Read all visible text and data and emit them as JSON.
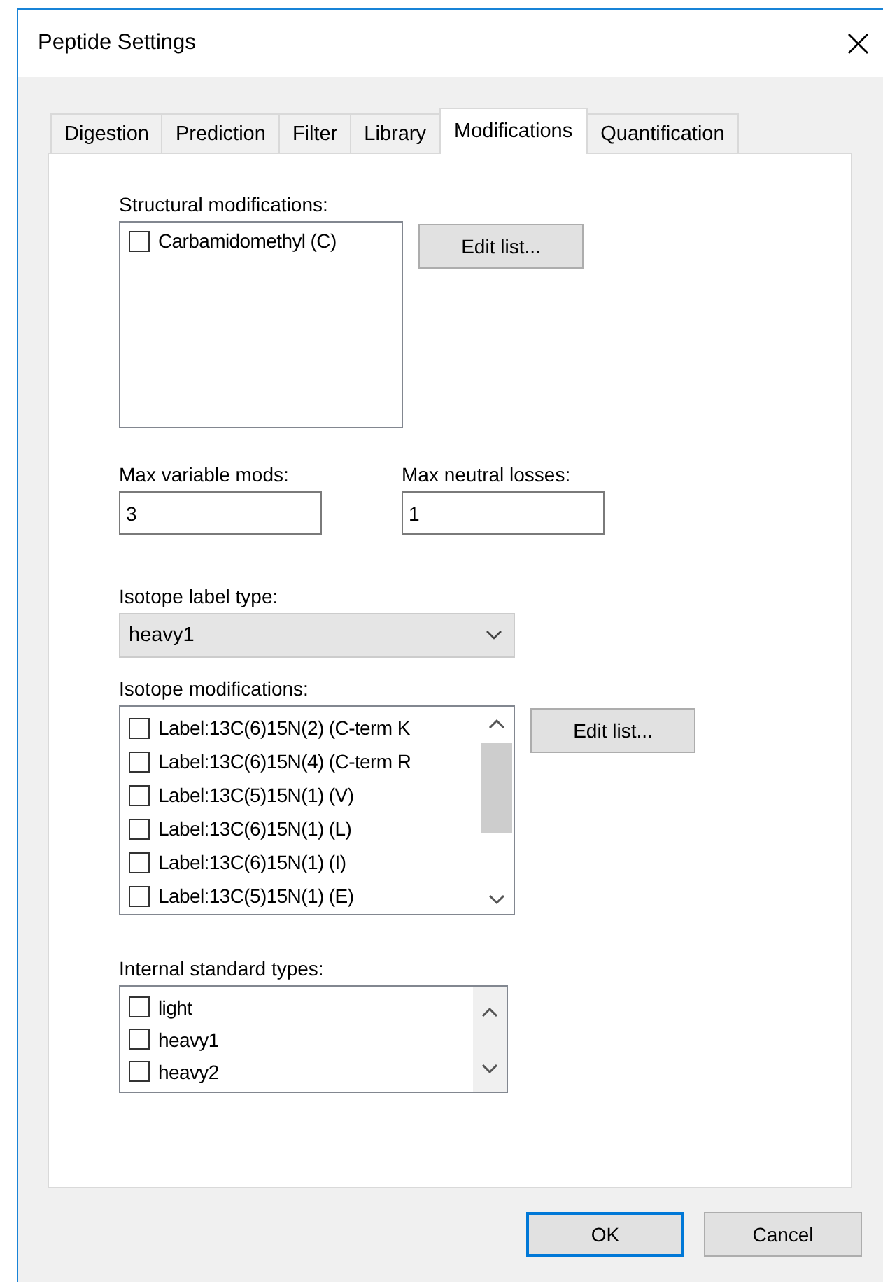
{
  "window": {
    "title": "Peptide Settings",
    "close": "×"
  },
  "tabs": [
    {
      "label": "Digestion",
      "selected": false
    },
    {
      "label": "Prediction",
      "selected": false
    },
    {
      "label": "Filter",
      "selected": false
    },
    {
      "label": "Library",
      "selected": false
    },
    {
      "label": "Modifications",
      "selected": true
    },
    {
      "label": "Quantification",
      "selected": false
    }
  ],
  "structural_modifications": {
    "label": "Structural modifications:",
    "items": [
      {
        "label": "Carbamidomethyl (C)",
        "checked": false
      }
    ],
    "button": "Edit list..."
  },
  "max_variable_mods": {
    "label": "Max variable mods:",
    "value": "3"
  },
  "max_neutral_losses": {
    "label": "Max neutral losses:",
    "value": "1"
  },
  "isotope_label_type": {
    "label": "Isotope label type:",
    "value": "heavy1"
  },
  "isotope_modifications": {
    "label": "Isotope modifications:",
    "items": [
      {
        "label": "Label:13C(6)15N(2) (C-term K",
        "checked": false
      },
      {
        "label": "Label:13C(6)15N(4) (C-term R",
        "checked": false
      },
      {
        "label": "Label:13C(5)15N(1) (V)",
        "checked": false
      },
      {
        "label": "Label:13C(6)15N(1) (L)",
        "checked": false
      },
      {
        "label": "Label:13C(6)15N(1) (I)",
        "checked": false
      },
      {
        "label": "Label:13C(5)15N(1) (E)",
        "checked": false
      }
    ],
    "button": "Edit list..."
  },
  "internal_standard_types": {
    "label": "Internal standard types:",
    "items": [
      {
        "label": "light",
        "checked": false
      },
      {
        "label": "heavy1",
        "checked": false
      },
      {
        "label": "heavy2",
        "checked": false
      }
    ]
  },
  "buttons": [
    {
      "label": "OK",
      "default": true
    },
    {
      "label": "Cancel",
      "default": false
    }
  ]
}
